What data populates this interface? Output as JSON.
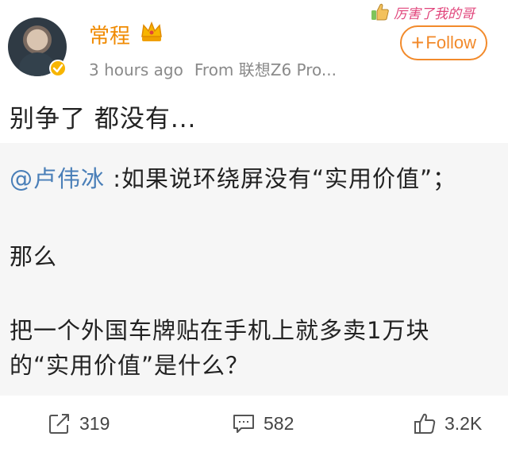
{
  "user": {
    "name": "常程",
    "time": "3 hours ago",
    "source": "From 联想Z6 Pro..."
  },
  "header": {
    "follow_label": "Follow",
    "sticker_text": "厉害了我的哥"
  },
  "post": {
    "text": "别争了 都没有..."
  },
  "quoted": {
    "mention": "@卢伟冰",
    "line1": " :如果说环绕屏没有“实用价值”；",
    "line2": "那么",
    "line3": "把一个外国车牌贴在手机上就多卖1万块",
    "line4": "的“实用价值”是什么？"
  },
  "actions": {
    "repost_count": "319",
    "comment_count": "582",
    "like_count": "3.2K"
  },
  "colors": {
    "accent": "#f28a2b",
    "mention": "#4a7fb8",
    "username": "#f08a00"
  }
}
